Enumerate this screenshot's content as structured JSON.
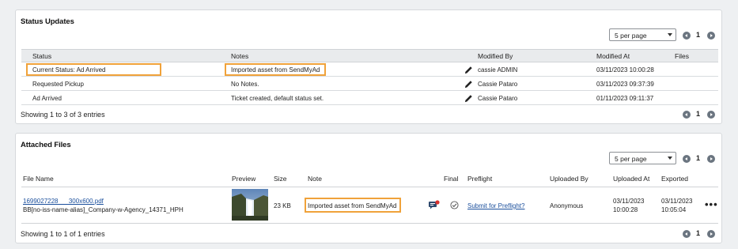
{
  "status_panel": {
    "title": "Status Updates",
    "per_page": "5 per page",
    "page": "1",
    "columns": [
      "Status",
      "Notes",
      "Modified By",
      "Modified At",
      "Files"
    ],
    "rows": [
      {
        "status": "Current Status: Ad Arrived",
        "notes": "Imported asset from SendMyAd",
        "modified_by": "cassie ADMIN",
        "modified_at": "03/11/2023 10:00:28",
        "files": ""
      },
      {
        "status": "Requested Pickup",
        "notes": "No Notes.",
        "modified_by": "Cassie Pataro",
        "modified_at": "03/11/2023 09:37:39",
        "files": ""
      },
      {
        "status": "Ad Arrived",
        "notes": "Ticket created, default status set.",
        "modified_by": "Cassie Pataro",
        "modified_at": "01/11/2023 09:11:37",
        "files": ""
      }
    ],
    "showing": "Showing 1 to 3 of 3 entries",
    "footer_page": "1"
  },
  "files_panel": {
    "title": "Attached Files",
    "per_page": "5 per page",
    "page": "1",
    "columns": [
      "File Name",
      "Preview",
      "Size",
      "Note",
      "Final",
      "Preflight",
      "Uploaded By",
      "Uploaded At",
      "Exported"
    ],
    "rows": [
      {
        "file_link": "1699027228___300x600.pdf",
        "file_sub": "BB[no-iss-name-alias]_Company-w-Agency_14371_HPH",
        "size": "23 KB",
        "note": "Imported asset from SendMyAd",
        "preflight": "Submit for Preflight?",
        "uploaded_by": "Anonymous",
        "uploaded_at_date": "03/11/2023",
        "uploaded_at_time": "10:00:28",
        "exported_date": "03/11/2023",
        "exported_time": "10:05:04",
        "more": "•••"
      }
    ],
    "showing": "Showing 1 to 1 of 1 entries",
    "footer_page": "1"
  },
  "icons": {
    "edit": "pencil-icon",
    "prev": "chevron-left-icon",
    "next": "chevron-right-icon",
    "comment": "comment-badge-icon",
    "check": "check-circle-icon",
    "more": "more-options-icon"
  },
  "colors": {
    "highlight": "#f0a23a",
    "link": "#1b4f9c",
    "pager": "#6b7580"
  }
}
